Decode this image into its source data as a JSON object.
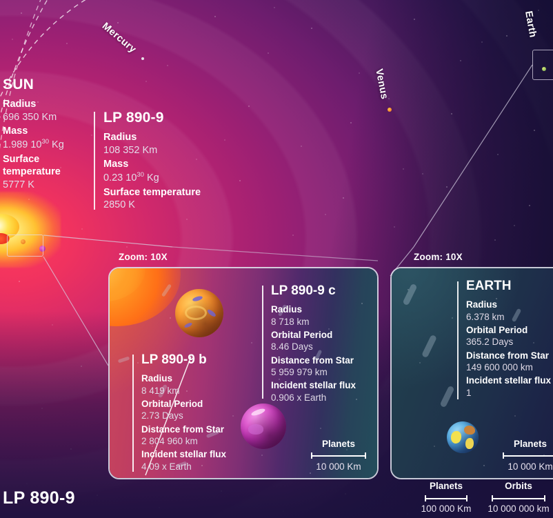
{
  "page": {
    "title": "LP 890-9"
  },
  "orbit_labels": [
    {
      "name": "Mercury"
    },
    {
      "name": "Venus"
    },
    {
      "name": "Earth"
    }
  ],
  "star_comparison": [
    {
      "title": "SUN",
      "rows": [
        {
          "key": "Radius",
          "value": "696 350 Km"
        },
        {
          "key": "Mass",
          "value_pre": "1.989 10",
          "value_sup": "30",
          "value_post": " Kg"
        },
        {
          "key": "Surface temperature",
          "value": "5777 K"
        }
      ]
    },
    {
      "title": "LP 890-9",
      "rows": [
        {
          "key": "Radius",
          "value": "108 352 Km"
        },
        {
          "key": "Mass",
          "value_pre": "0.23 10",
          "value_sup": "30",
          "value_post": " Kg"
        },
        {
          "key": "Surface temperature",
          "value": "2850 K"
        }
      ]
    }
  ],
  "insets": {
    "left": {
      "zoom_label": "Zoom: 10X",
      "planets": [
        {
          "title": "LP 890-9 b",
          "rows": [
            {
              "key": "Radius",
              "value": "8 419 km"
            },
            {
              "key": "Orbital Period",
              "value": "2.73 Days"
            },
            {
              "key": "Distance from Star",
              "value": "2 804 960 km"
            },
            {
              "key": "Incident stellar flux",
              "value": "4.09 x Earth"
            }
          ]
        },
        {
          "title": "LP 890-9 c",
          "rows": [
            {
              "key": "Radius",
              "value": "8 718 km"
            },
            {
              "key": "Orbital Period",
              "value": "8.46 Days"
            },
            {
              "key": "Distance from Star",
              "value": "5 959 979 km"
            },
            {
              "key": "Incident stellar flux",
              "value": "0.906 x Earth"
            }
          ]
        }
      ],
      "scale": {
        "caption": "Planets",
        "value": "10 000 Km"
      }
    },
    "right": {
      "zoom_label": "Zoom: 10X",
      "planets": [
        {
          "title": "EARTH",
          "rows": [
            {
              "key": "Radius",
              "value": "6.378 km"
            },
            {
              "key": "Orbital Period",
              "value": "365.2 Days"
            },
            {
              "key": "Distance from Star",
              "value": "149 600 000 km"
            },
            {
              "key": "Incident stellar flux",
              "value": "1"
            }
          ]
        }
      ],
      "scale": {
        "caption": "Planets",
        "value": "10 000 Km"
      }
    }
  },
  "bottom_legend": [
    {
      "caption": "Planets",
      "value": "100 000 Km"
    },
    {
      "caption": "Orbits",
      "value": "10 000 000 km"
    }
  ],
  "colors": {
    "sun_core": "#ffe352",
    "planet_b": "#ef7e25",
    "planet_c": "#c132b4",
    "earth": "#3f8fd1",
    "sky_hot": "#ff3b5c",
    "sky_deep": "#160e33"
  }
}
